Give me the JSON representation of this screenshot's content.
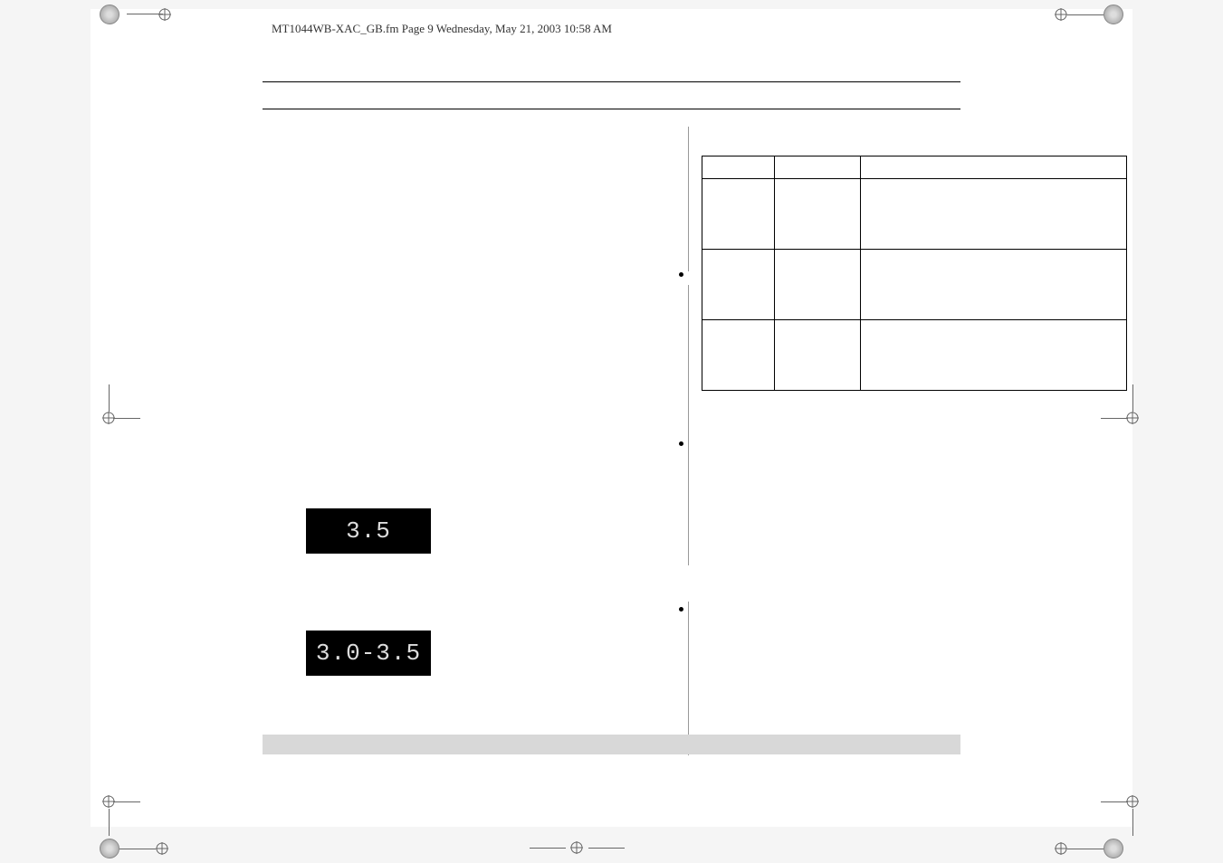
{
  "header": {
    "filename": "MT1044WB-XAC_GB.fm  Page 9  Wednesday, May 21, 2003  10:58 AM"
  },
  "displays": {
    "display1": "3.5",
    "display2": "3.0-3.5"
  }
}
